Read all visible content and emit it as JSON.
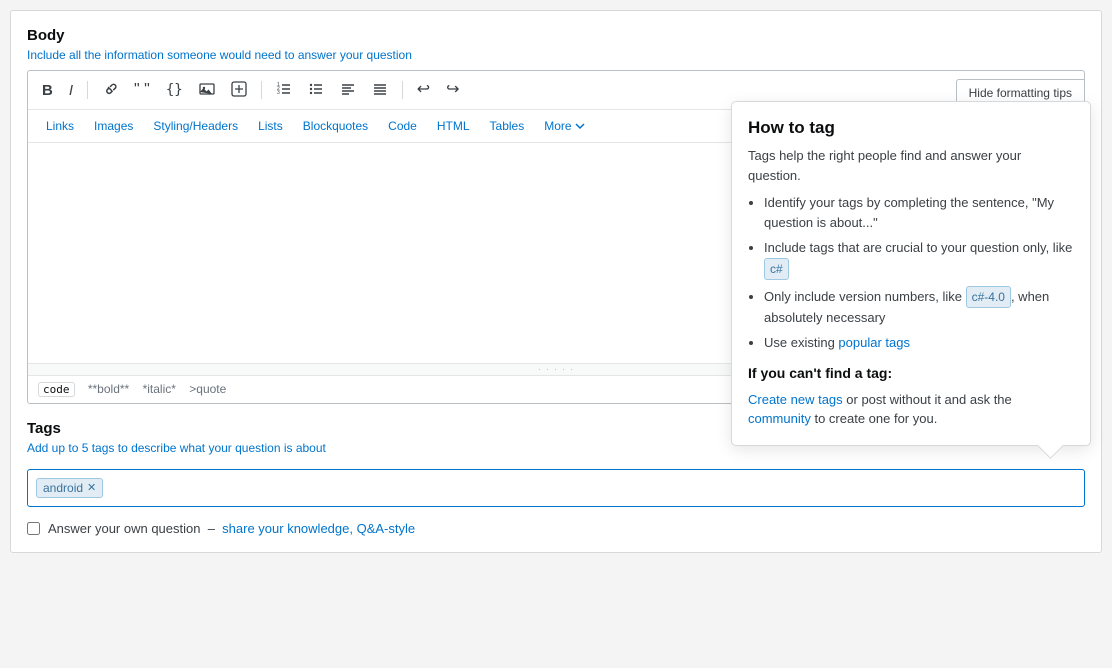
{
  "page": {
    "body_label": "Body",
    "body_hint": "Include all the information someone would need to answer your question",
    "hide_formatting_btn": "Hide formatting tips",
    "toolbar": {
      "bold": "B",
      "italic": "I",
      "link_icon": "🔗",
      "quote_icon": "“”",
      "code_icon": "{}",
      "image_icon": "🖼",
      "snippet_icon": "◇",
      "numbered_list": "≡",
      "bullet_list": "≡",
      "align_left": "≡",
      "align_full": "≡",
      "undo": "↩",
      "redo": "↪"
    },
    "formatting_tabs": [
      "Links",
      "Images",
      "Styling/Headers",
      "Lists",
      "Blockquotes",
      "Code",
      "HTML",
      "Tables"
    ],
    "more_label": "More",
    "resize_handle": "· · · · ·",
    "syntax_hints": {
      "code": "code",
      "bold": "**bold**",
      "italic": "*italic*",
      "quote": ">quote"
    },
    "tags_section": {
      "title": "Tags",
      "hint": "Add up to 5 tags to describe what your question is about",
      "help_icon": "?",
      "tags": [
        "android"
      ],
      "tag_remove": "×"
    },
    "answer_section": {
      "checkbox_label": "Answer your own question",
      "link_text": "share your knowledge, Q&A-style"
    },
    "tooltip": {
      "title": "How to tag",
      "intro": "Tags help the right people find and answer your question.",
      "tips": [
        "Identify your tags by completing the sentence, \"My question is about...\"",
        "Include tags that are crucial to your question only, like",
        "Only include version numbers, like",
        "when absolutely necessary",
        "Use existing popular tags"
      ],
      "tip1_tag": "c#",
      "tip2_tag": "c#-4.0",
      "cant_find_title": "If you can't find a tag:",
      "cant_find_text1": "Create new tags",
      "cant_find_text2": "or post without it and ask the community",
      "cant_find_text3": "to create one for you."
    }
  }
}
